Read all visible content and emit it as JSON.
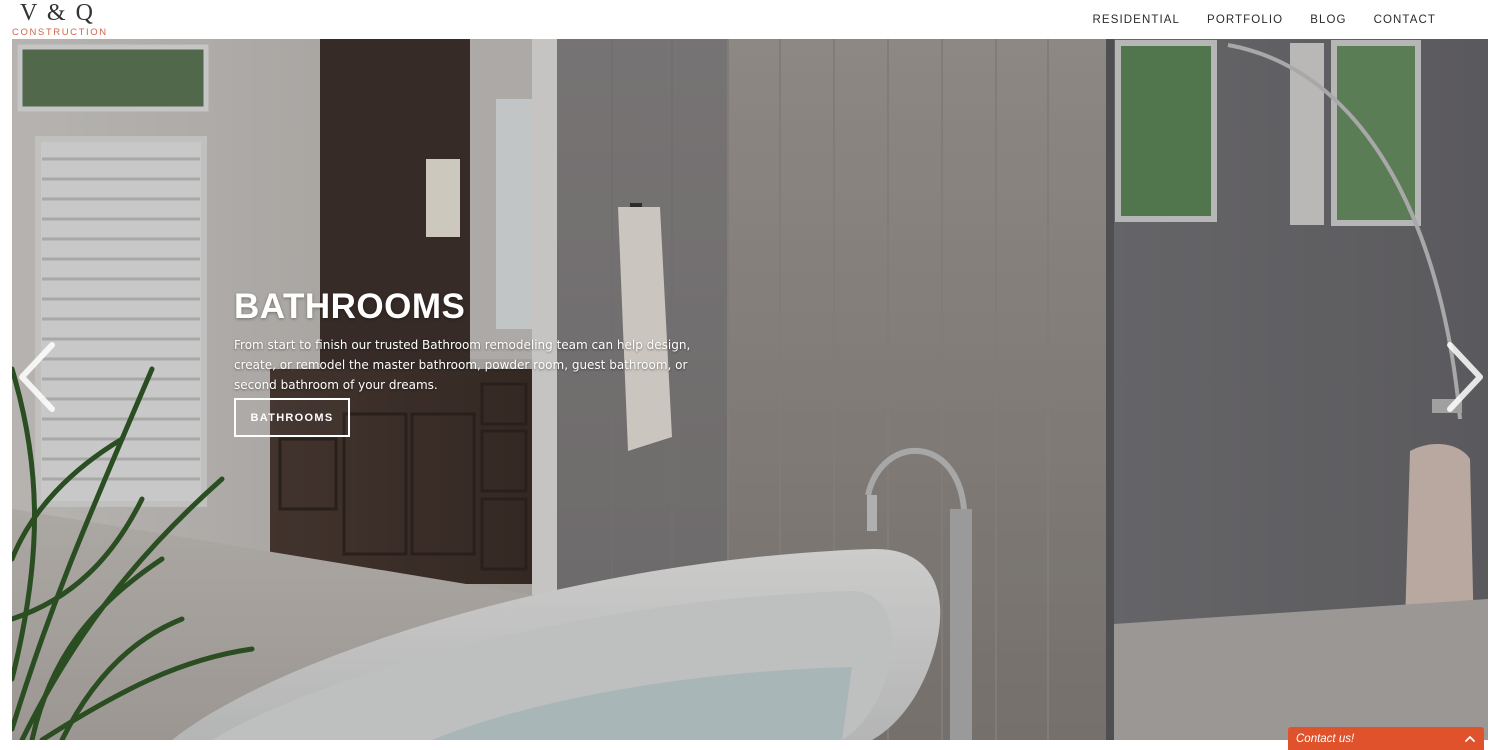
{
  "brand": {
    "logo_mark": "V & Q",
    "logo_sub": "CONSTRUCTION",
    "accent_color": "#d2674a"
  },
  "nav": {
    "items": [
      {
        "label": "RESIDENTIAL"
      },
      {
        "label": "PORTFOLIO"
      },
      {
        "label": "BLOG"
      },
      {
        "label": "CONTACT"
      }
    ]
  },
  "hero": {
    "slide": {
      "title": "BATHROOMS",
      "text": "From start to finish our trusted Bathroom remodeling team can help design, create, or remodel the master bathroom, powder room, guest bathroom, or second bathroom of your dreams.",
      "button_label": "BATHROOMS"
    },
    "prev_icon": "chevron-left-icon",
    "next_icon": "chevron-right-icon"
  },
  "contact_widget": {
    "label": "Contact us!",
    "icon": "chevron-up-icon",
    "color": "#e0522b"
  }
}
